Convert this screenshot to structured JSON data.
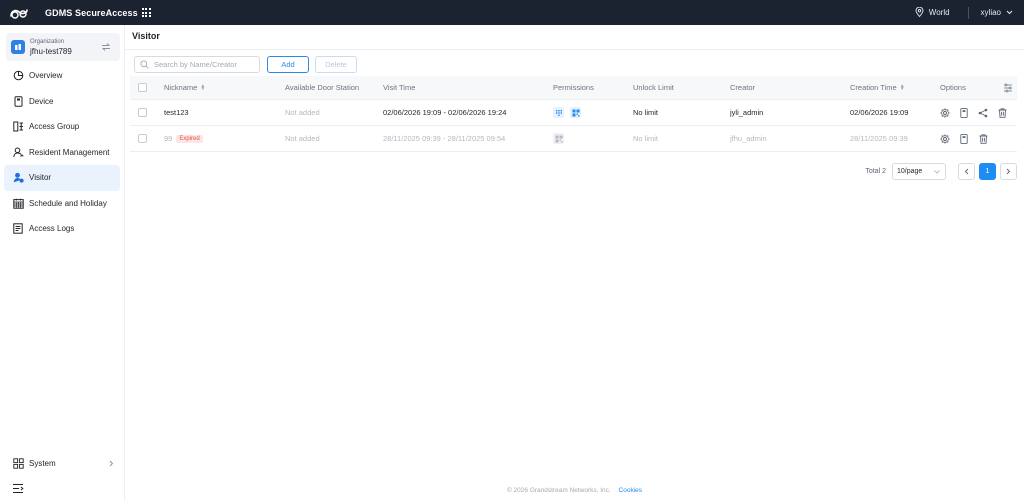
{
  "app": {
    "title": "GDMS SecureAccess"
  },
  "header": {
    "region": "World",
    "user": "xyliao"
  },
  "org": {
    "label": "Organization",
    "name": "jfhu-test789"
  },
  "sidebar": {
    "items": [
      {
        "label": "Overview",
        "icon": "overview-icon"
      },
      {
        "label": "Device",
        "icon": "device-icon"
      },
      {
        "label": "Access Group",
        "icon": "access-group-icon"
      },
      {
        "label": "Resident Management",
        "icon": "resident-icon"
      },
      {
        "label": "Visitor",
        "icon": "visitor-icon",
        "active": true
      },
      {
        "label": "Schedule and Holiday",
        "icon": "calendar-icon"
      },
      {
        "label": "Access Logs",
        "icon": "logs-icon"
      }
    ],
    "system_label": "System"
  },
  "page": {
    "title": "Visitor"
  },
  "toolbar": {
    "search_placeholder": "Search by Name/Creator",
    "add_label": "Add",
    "delete_label": "Delete"
  },
  "table": {
    "headers": {
      "nickname": "Nickname",
      "door": "Available Door Station",
      "visit": "Visit Time",
      "permissions": "Permissions",
      "unlock": "Unlock Limit",
      "creator": "Creator",
      "ctime": "Creation Time",
      "options": "Options"
    },
    "rows": [
      {
        "nickname": "test123",
        "badge": "",
        "door": "Not added",
        "visit": "02/06/2026 19:09 - 02/06/2026 19:24",
        "unlock": "No limit",
        "creator": "jyli_admin",
        "ctime": "02/06/2026 19:09"
      },
      {
        "nickname": "99",
        "badge": "Expired",
        "door": "Not added",
        "visit": "28/11/2025 09:39 - 28/11/2025 09:54",
        "unlock": "No limit",
        "creator": "jfhu_admin",
        "ctime": "28/11/2025 09:39"
      }
    ]
  },
  "pagination": {
    "total": "Total 2",
    "page_size": "10/page",
    "current_page": "1"
  },
  "footer": {
    "copyright": "© 2026 Grandstream Networks, Inc.",
    "cookies": "Cookies"
  },
  "colors": {
    "topbar": "#1b2330",
    "accent": "#1e8cf0",
    "expired": "#e5544a"
  }
}
